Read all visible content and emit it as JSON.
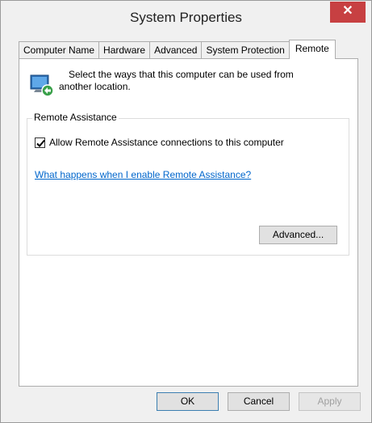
{
  "window": {
    "title": "System Properties",
    "close_glyph": "✕"
  },
  "tabs": [
    {
      "label": "Computer Name"
    },
    {
      "label": "Hardware"
    },
    {
      "label": "Advanced"
    },
    {
      "label": "System Protection"
    },
    {
      "label": "Remote",
      "active": true
    }
  ],
  "remote": {
    "intro_text": "Select the ways that this computer can be used from another location.",
    "intro_icon": "remote-connection-icon",
    "group_label": "Remote Assistance",
    "allow_checkbox": {
      "label": "Allow Remote Assistance connections to this computer",
      "checked": true
    },
    "help_link": "What happens when I enable Remote Assistance?",
    "advanced_button": "Advanced..."
  },
  "footer": {
    "ok": "OK",
    "cancel": "Cancel",
    "apply": "Apply"
  },
  "colors": {
    "close_button": "#c74042",
    "link": "#0066cc"
  }
}
